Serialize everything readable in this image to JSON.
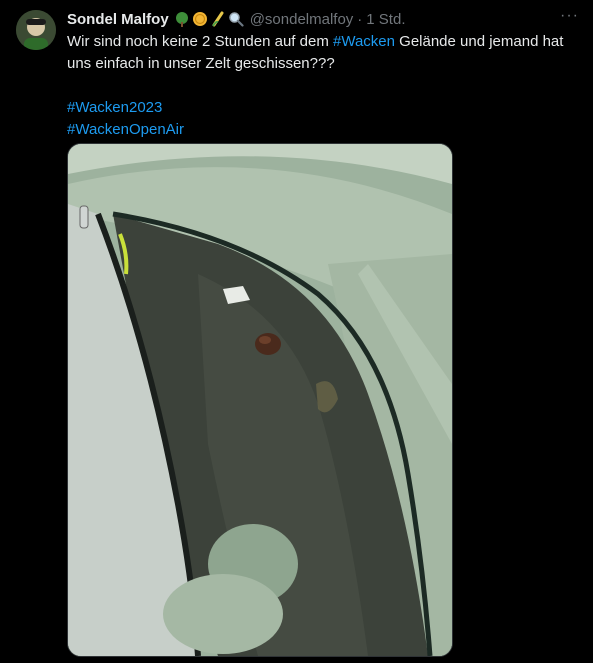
{
  "author": {
    "display_name": "Sondel Malfoy",
    "handle": "@sondelmalfoy",
    "badge_icons": [
      "tree-icon",
      "coin-icon",
      "corn-icon",
      "magnifier-icon"
    ]
  },
  "meta": {
    "separator": "·",
    "time": "1 Std.",
    "more_label": "···"
  },
  "tweet": {
    "text_part1": "Wir sind noch keine 2 Stunden auf dem ",
    "hashtag_inline": "#Wacken",
    "text_part2": " Gelände und jemand hat uns einfach in unser Zelt geschissen???",
    "hashtags": [
      "#Wacken2023",
      "#WackenOpenAir"
    ]
  },
  "colors": {
    "background": "#000000",
    "text": "#e7e9ea",
    "muted": "#71767b",
    "link": "#1d9bf0"
  }
}
